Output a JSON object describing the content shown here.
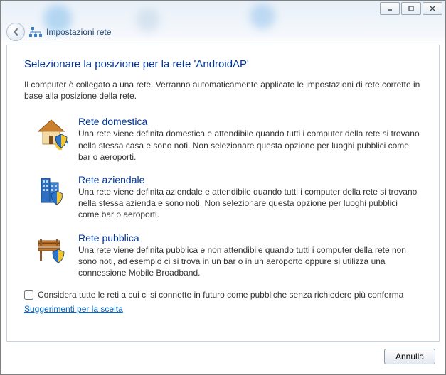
{
  "window": {
    "header_title": "Impostazioni rete"
  },
  "heading": "Selezionare la posizione per la rete 'AndroidAP'",
  "intro": "Il computer è collegato a una rete. Verranno automaticamente applicate le impostazioni di rete corrette in base alla posizione della rete.",
  "options": {
    "home": {
      "title": "Rete domestica",
      "desc": "Una rete viene definita domestica e attendibile quando tutti i computer della rete si trovano nella stessa casa e sono noti. Non selezionare questa opzione per luoghi pubblici come bar o aeroporti."
    },
    "work": {
      "title": "Rete aziendale",
      "desc": "Una rete viene definita aziendale e attendibile quando tutti i computer della rete si trovano nella stessa azienda e sono noti. Non selezionare questa opzione per luoghi pubblici come bar o aeroporti."
    },
    "public": {
      "title": "Rete pubblica",
      "desc": "Una rete viene definita pubblica e non attendibile quando tutti i computer della rete non sono noti, ad esempio ci si trova in un bar o in un aeroporto oppure si utilizza una connessione Mobile Broadband."
    }
  },
  "checkbox_label": "Considera tutte le reti a cui ci si connette in futuro come pubbliche senza richiedere più conferma",
  "help_link": "Suggerimenti per la scelta",
  "buttons": {
    "cancel": "Annulla"
  }
}
